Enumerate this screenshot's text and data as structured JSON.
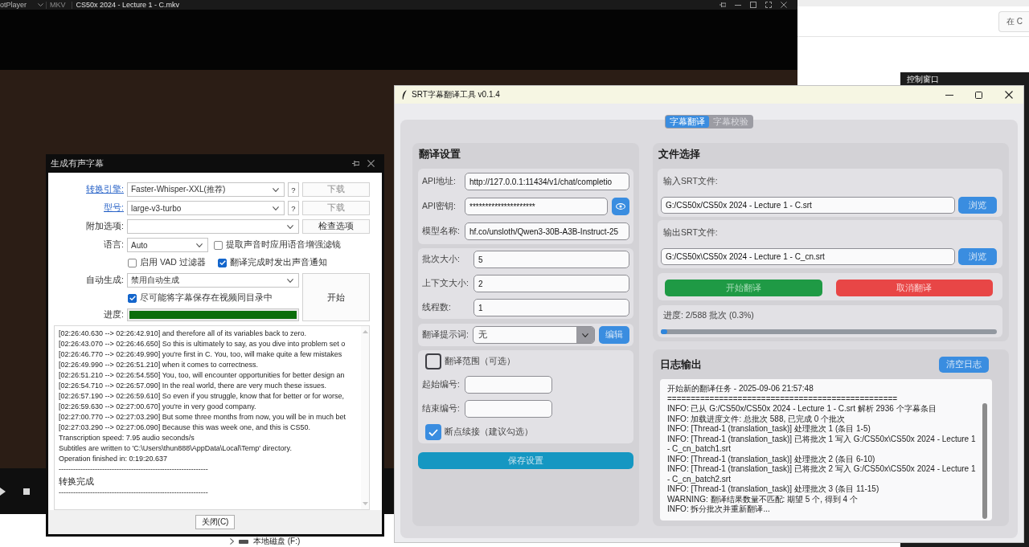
{
  "player": {
    "app_name": "otPlayer",
    "format": "MKV",
    "file_title": "CS50x 2024 - Lecture 1 - C.mkv"
  },
  "file_explorer": {
    "tree_items": [
      {
        "label": "本地磁盘 (F:)",
        "expanded": false
      }
    ]
  },
  "browser": {
    "search": {
      "placeholder": "在 C"
    }
  },
  "control_window": {
    "title": "控制窗口"
  },
  "subtitle_dialog": {
    "title": "生成有声字幕",
    "engine": {
      "label": "转换引擎:",
      "value": "Faster-Whisper-XXL(推荐)",
      "help_button": "?",
      "download_button": {
        "label": "下载",
        "disabled": true
      }
    },
    "model": {
      "label": "型号:",
      "value": "large-v3-turbo",
      "help_button": "?",
      "download_button": {
        "label": "下载",
        "disabled": true
      }
    },
    "extra_options": {
      "label": "附加选项:",
      "check_button": "检查选项"
    },
    "language": {
      "label": "语言:",
      "value": "Auto"
    },
    "speech_enhance": {
      "label": "提取声音时应用语音增强滤镜",
      "checked": false
    },
    "vad_filter": {
      "label": "启用 VAD 过滤器",
      "checked": false
    },
    "sound_notify": {
      "label": "翻译完成时发出声音通知",
      "checked": true
    },
    "auto_generate": {
      "label": "自动生成:",
      "value": "禁用自动生成"
    },
    "save_beside_video": {
      "label": "尽可能将字幕保存在视频同目录中",
      "checked": true
    },
    "start_button": "开始",
    "progress": {
      "label": "进度:",
      "level": 1
    },
    "log_lines": [
      {
        "kind": "line",
        "text": "[02:26:40.630 --> 02:26:42.910] and therefore all of its variables back to zero."
      },
      {
        "kind": "line",
        "text": "[02:26:43.070 --> 02:26:46.650] So this is ultimately to say, as you dive into problem set o"
      },
      {
        "kind": "line",
        "text": "[02:26:46.770 --> 02:26:49.990] you're first in C. You, too, will make quite a few mistakes"
      },
      {
        "kind": "line",
        "text": "[02:26:49.990 --> 02:26:51.210] when it comes to correctness."
      },
      {
        "kind": "line",
        "text": "[02:26:51.210 --> 02:26:54.550] You, too, will encounter opportunities for better design an"
      },
      {
        "kind": "line",
        "text": "[02:26:54.710 --> 02:26:57.090] In the real world, there are very much these issues."
      },
      {
        "kind": "line",
        "text": "[02:26:57.190 --> 02:26:59.610] So even if you struggle, know that for better or for worse,"
      },
      {
        "kind": "line",
        "text": "[02:26:59.630 --> 02:27:00.670] you're in very good company."
      },
      {
        "kind": "line",
        "text": "[02:27:00.770 --> 02:27:03.290] But some three months from now, you will be in much bet"
      },
      {
        "kind": "line",
        "text": "[02:27:03.290 --> 02:27:06.090] Because this was week one, and this is CS50."
      },
      {
        "kind": "line",
        "text": "Transcription speed: 7.95 audio seconds/s"
      },
      {
        "kind": "line",
        "text": "Subtitles are written to 'C:\\Users\\thun888\\AppData\\Local\\Temp' directory."
      },
      {
        "kind": "line",
        "text": "Operation finished in: 0:19:20.637"
      },
      {
        "kind": "line",
        "text": "--------------------------------------------------------------"
      },
      {
        "kind": "status",
        "text": "转换完成"
      },
      {
        "kind": "line",
        "text": "--------------------------------------------------------------"
      }
    ],
    "close_button": "关闭(C)"
  },
  "srt_tool": {
    "title": "SRT字幕翻译工具 v0.1.4",
    "tabs": [
      {
        "label": "字幕翻译",
        "selected": true
      },
      {
        "label": "字幕校验",
        "selected": false
      }
    ],
    "settings": {
      "heading": "翻译设置",
      "api_fields": [
        {
          "kind": "text",
          "label": "API地址:",
          "value": "http://127.0.0.1:11434/v1/chat/completio"
        },
        {
          "kind": "secret",
          "label": "API密钥:",
          "value": "*********************"
        },
        {
          "kind": "text",
          "label": "模型名称:",
          "value": "hf.co/unsloth/Qwen3-30B-A3B-Instruct-25"
        }
      ],
      "number_fields": [
        {
          "label": "批次大小:",
          "value": "5"
        },
        {
          "label": "上下文大小:",
          "value": "2"
        },
        {
          "label": "线程数:",
          "value": "1"
        }
      ],
      "prompt": {
        "label": "翻译提示词:",
        "value": "无",
        "edit_button": "编辑"
      },
      "range": {
        "label": "翻译范围（可选）",
        "checked": false,
        "start_label": "起始编号:",
        "end_label": "结束编号:"
      },
      "resume": {
        "label": "断点续接（建议勾选）",
        "checked": true
      },
      "save_button": "保存设置"
    },
    "files": {
      "heading": "文件选择",
      "input": {
        "label": "输入SRT文件:",
        "value": "G:/CS50x/CS50x 2024 - Lecture 1 - C.srt",
        "browse_button": "浏览"
      },
      "output": {
        "label": "输出SRT文件:",
        "value": "G:/CS50x\\CS50x 2024 - Lecture 1 - C_cn.srt",
        "browse_button": "浏览"
      },
      "start_button": "开始翻译",
      "cancel_button": "取消翻译",
      "progress": {
        "text": "进度: 2/588 批次 (0.3%)",
        "level": 0.003
      }
    },
    "log": {
      "heading": "日志输出",
      "clear_button": "清空日志",
      "lines": [
        "开始新的翻译任务 - 2025-09-06 21:57:48",
        "=================================================",
        "INFO: 已从 G:/CS50x/CS50x 2024 - Lecture 1 - C.srt 解析 2936 个字幕条目",
        "INFO: 加载进度文件: 总批次 588, 已完成 0 个批次",
        "INFO: [Thread-1 (translation_task)] 处理批次 1 (条目 1-5)",
        "INFO: [Thread-1 (translation_task)] 已将批次 1 写入 G:/CS50x\\CS50x 2024 - Lecture 1 - C_cn_batch1.srt",
        "INFO: [Thread-1 (translation_task)] 处理批次 2 (条目 6-10)",
        "INFO: [Thread-1 (translation_task)] 已将批次 2 写入 G:/CS50x\\CS50x 2024 - Lecture 1 - C_cn_batch2.srt",
        "INFO: [Thread-1 (translation_task)] 处理批次 3 (条目 11-15)",
        "WARNING: 翻译结果数量不匹配: 期望 5 个, 得到 4 个",
        "INFO: 拆分批次并重新翻译..."
      ]
    }
  }
}
